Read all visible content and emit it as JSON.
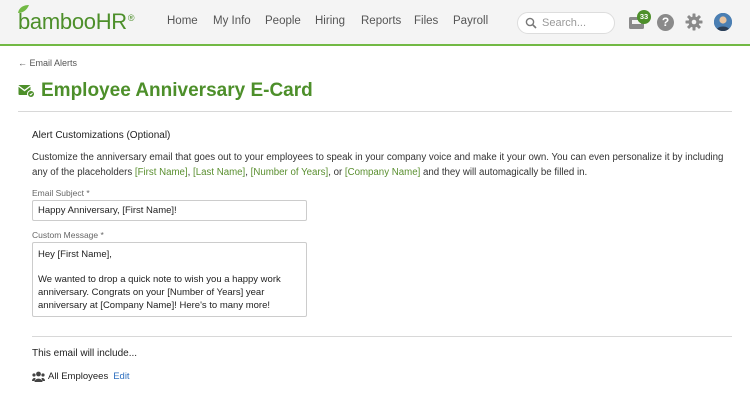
{
  "brand": {
    "name": "bambooHR",
    "trademark": "®",
    "accent": "#4d8f2a"
  },
  "nav": {
    "items": [
      {
        "label": "Home"
      },
      {
        "label": "My Info"
      },
      {
        "label": "People"
      },
      {
        "label": "Hiring"
      },
      {
        "label": "Reports"
      },
      {
        "label": "Files"
      },
      {
        "label": "Payroll"
      }
    ]
  },
  "search": {
    "placeholder": "Search..."
  },
  "inbox": {
    "count": "33"
  },
  "help": {
    "label": "?"
  },
  "breadcrumb": {
    "back_label": "← Email Alerts"
  },
  "page": {
    "title": "Employee Anniversary E-Card"
  },
  "customizations": {
    "section_title": "Alert Customizations (Optional)",
    "description_before": "Customize the anniversary email that goes out to your employees to speak in your company voice and make it your own. You can even personalize it by including any of the placeholders ",
    "placeholders": [
      "[First Name]",
      "[Last Name]",
      "[Number of Years]",
      "[Company Name]"
    ],
    "sep1": ", ",
    "sep2": ", ",
    "sep3": ", or ",
    "description_after": " and they will automagically be filled in."
  },
  "email_subject": {
    "label": "Email Subject *",
    "value": "Happy Anniversary, [First Name]!"
  },
  "custom_message": {
    "label": "Custom Message *",
    "line1": "Hey [First Name],",
    "line2": "We wanted to drop a quick note to wish you a happy work",
    "line3": "anniversary. Congrats on your [Number of Years] year",
    "line4": "anniversary at [Company Name]! Here's to many more!"
  },
  "include": {
    "title": "This email will include...",
    "recipients": "All Employees",
    "edit_label": "Edit"
  }
}
